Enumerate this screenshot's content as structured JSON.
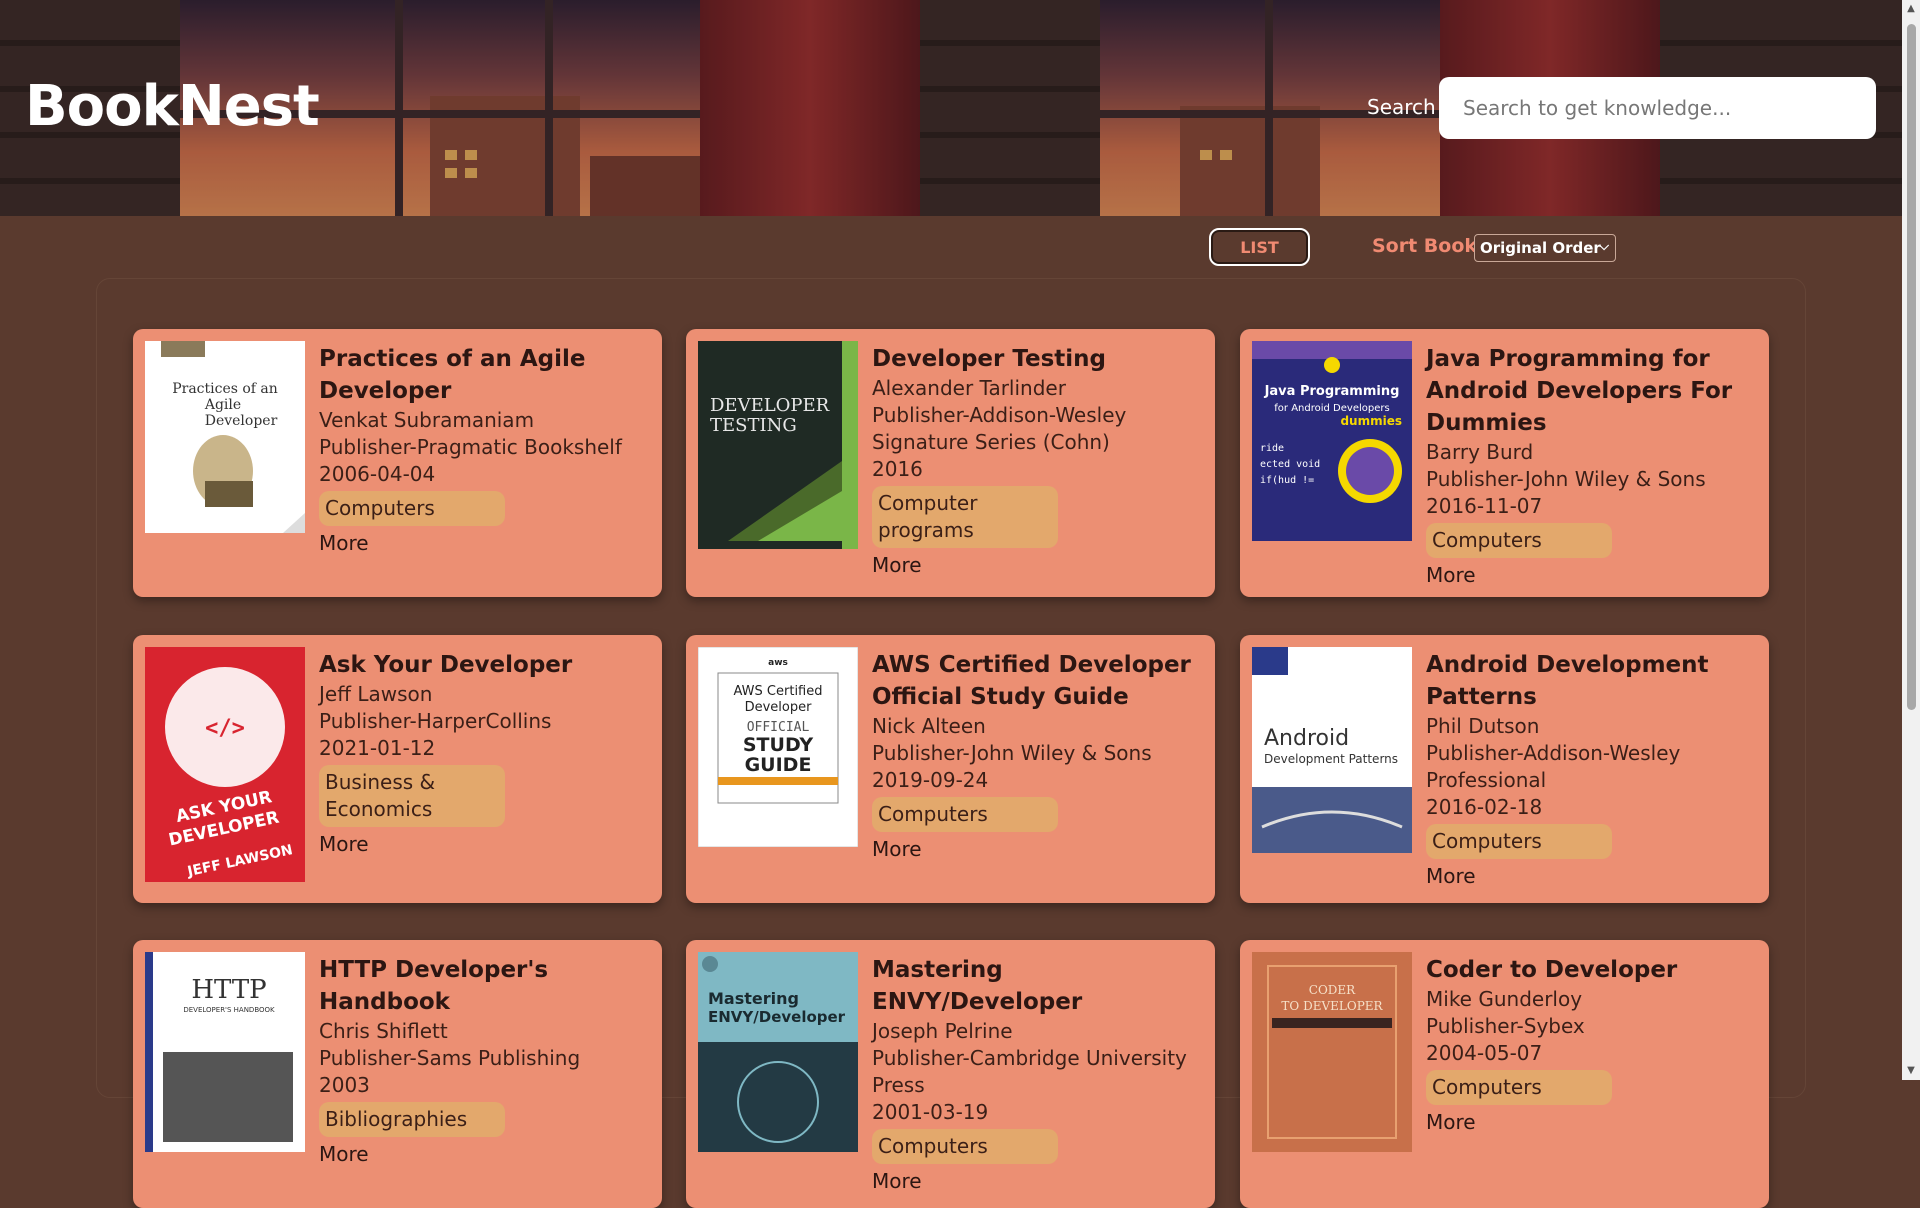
{
  "header": {
    "brand": "BookNest",
    "search_label": "Search",
    "search_placeholder": "Search to get knowledge..."
  },
  "toolbar": {
    "list_button": "LIST",
    "sort_label": "Sort Book",
    "sort_selected": "Original Order"
  },
  "books": [
    {
      "title": "Practices of an Agile Developer",
      "author": "Venkat Subramaniam",
      "publisher": "Publisher-Pragmatic Bookshelf",
      "date": "2006-04-04",
      "category": "Computers",
      "more": "More",
      "cover": {
        "bg": "#ffffff",
        "accent": "#8a7a5a",
        "text": "Practices of an Agile Developer",
        "text_color": "#333333"
      }
    },
    {
      "title": "Developer Testing",
      "author": "Alexander Tarlinder",
      "publisher": "Publisher-Addison-Wesley Signature Series (Cohn)",
      "date": "2016",
      "category": "Computer programs",
      "more": "More",
      "cover": {
        "bg": "#1f2a24",
        "accent": "#7ab648",
        "text": "DEVELOPER TESTING",
        "text_color": "#e8e8e8"
      }
    },
    {
      "title": "Java Programming for Android Developers For Dummies",
      "author": "Barry Burd",
      "publisher": "Publisher-John Wiley & Sons",
      "date": "2016-11-07",
      "category": "Computers",
      "more": "More",
      "cover": {
        "bg": "#2a2a7a",
        "accent": "#f5d800",
        "text": "Java Programming for Android Developers",
        "text_color": "#ffffff"
      }
    },
    {
      "title": "Ask Your Developer",
      "author": "Jeff Lawson",
      "publisher": "Publisher-HarperCollins",
      "date": "2021-01-12",
      "category": "Business & Economics",
      "more": "More",
      "cover": {
        "bg": "#d8242f",
        "accent": "#ffffff",
        "text": "ASK YOUR DEVELOPER",
        "text_color": "#ffffff"
      }
    },
    {
      "title": "AWS Certified Developer Official Study Guide",
      "author": "Nick Alteen",
      "publisher": "Publisher-John Wiley & Sons",
      "date": "2019-09-24",
      "category": "Computers",
      "more": "More",
      "cover": {
        "bg": "#ffffff",
        "accent": "#e8961e",
        "text": "AWS Certified Developer OFFICIAL STUDY GUIDE",
        "text_color": "#222222"
      }
    },
    {
      "title": "Android Development Patterns",
      "author": "Phil Dutson",
      "publisher": "Publisher-Addison-Wesley Professional",
      "date": "2016-02-18",
      "category": "Computers",
      "more": "More",
      "cover": {
        "bg": "#ffffff",
        "accent": "#2a3a8a",
        "text": "Android Development Patterns",
        "text_color": "#333333"
      }
    },
    {
      "title": "HTTP Developer's Handbook",
      "author": "Chris Shiflett",
      "publisher": "Publisher-Sams Publishing",
      "date": "2003",
      "category": "Bibliographies",
      "more": "More",
      "cover": {
        "bg": "#ffffff",
        "accent": "#2a3a8a",
        "text": "HTTP",
        "text_color": "#333333"
      }
    },
    {
      "title": "Mastering ENVY/Developer",
      "author": "Joseph Pelrine",
      "publisher": "Publisher-Cambridge University Press",
      "date": "2001-03-19",
      "category": "Computers",
      "more": "More",
      "cover": {
        "bg": "#7fb8c4",
        "accent": "#233a44",
        "text": "Mastering ENVY/Developer",
        "text_color": "#1a2a30"
      }
    },
    {
      "title": "Coder to Developer",
      "author": "Mike Gunderloy",
      "publisher": "Publisher-Sybex",
      "date": "2004-05-07",
      "category": "Computers",
      "more": "More",
      "cover": {
        "bg": "#c8704a",
        "accent": "#e8a070",
        "text": "CODER TO DEVELOPER",
        "text_color": "#f6e0c8"
      }
    }
  ]
}
